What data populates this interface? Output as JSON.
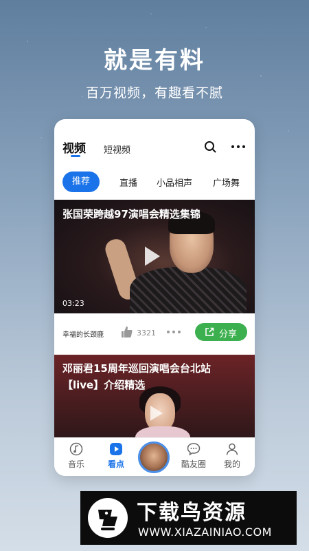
{
  "promo": {
    "headline": "就是有料",
    "subline": "百万视频，有趣看不腻"
  },
  "topbar": {
    "tabs": [
      {
        "label": "视频",
        "active": true
      },
      {
        "label": "短视频",
        "active": false
      }
    ],
    "icons": [
      "search-icon",
      "more-icon"
    ]
  },
  "categories": [
    {
      "label": "推荐",
      "active": true
    },
    {
      "label": "直播"
    },
    {
      "label": "小品相声"
    },
    {
      "label": "广场舞"
    }
  ],
  "videos": [
    {
      "title": "张国荣跨越97演唱会精选集锦",
      "duration": "03:23",
      "author": "幸福的长颈鹿",
      "likes": "3321",
      "share_label": "分享"
    },
    {
      "title_line1": "邓丽君15周年巡回演唱会台北站",
      "title_line2": "【live】介绍精选"
    }
  ],
  "bottom_nav": [
    {
      "label": "音乐",
      "icon": "music-icon"
    },
    {
      "label": "看点",
      "icon": "play-icon",
      "active": true
    },
    {
      "label": "",
      "icon": "avatar"
    },
    {
      "label": "酷友圈",
      "icon": "chat-icon"
    },
    {
      "label": "我的",
      "icon": "user-icon"
    }
  ],
  "banner": {
    "title": "下载鸟资源",
    "url": "WWW.XIAZAINIAO.COM"
  },
  "colors": {
    "accent": "#1a73e8",
    "share_green": "#3cb04e"
  }
}
